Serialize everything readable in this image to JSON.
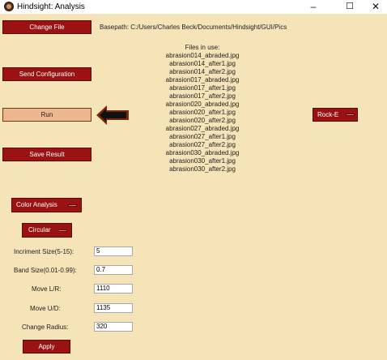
{
  "window": {
    "title": "Hindsight: Analysis",
    "minimize": "–",
    "maximize": "☐",
    "close": "✕"
  },
  "buttons": {
    "change_file": "Change File",
    "send_configuration": "Send Configuration",
    "run": "Run",
    "save_result": "Save Result",
    "apply": "Apply"
  },
  "basepath": "Basepath: C:/Users/Charles Beck/Documents/Hindsight/GUI/Pics",
  "files": {
    "header": "Files in use:",
    "list": [
      "abrasion014_abraded.jpg",
      "abrasion014_after1.jpg",
      "abrasion014_after2.jpg",
      "abrasion017_abraded.jpg",
      "abrasion017_after1.jpg",
      "abrasion017_after2.jpg",
      "abrasion020_abraded.jpg",
      "abrasion020_after1.jpg",
      "abrasion020_after2.jpg",
      "abrasion027_abraded.jpg",
      "abrasion027_after1.jpg",
      "abrasion027_after2.jpg",
      "abrasion030_abraded.jpg",
      "abrasion030_after1.jpg",
      "abrasion030_after2.jpg"
    ]
  },
  "menus": {
    "rock": "Rock-E",
    "analysis": "Color Analysis",
    "shape": "Circular"
  },
  "fields": [
    {
      "label": "Incriment Size(5-15):",
      "value": "5"
    },
    {
      "label": "Band Size(0.01-0.99):",
      "value": "0.7"
    },
    {
      "label": "Move L/R:",
      "value": "1110"
    },
    {
      "label": "Move U/D:",
      "value": "1135"
    },
    {
      "label": "Change Radius:",
      "value": "320"
    }
  ],
  "icons": {
    "arrow": "left-arrow-icon"
  },
  "colors": {
    "background": "#f5e4b8",
    "button": "#9b1212",
    "run_button": "#ecb68f"
  }
}
